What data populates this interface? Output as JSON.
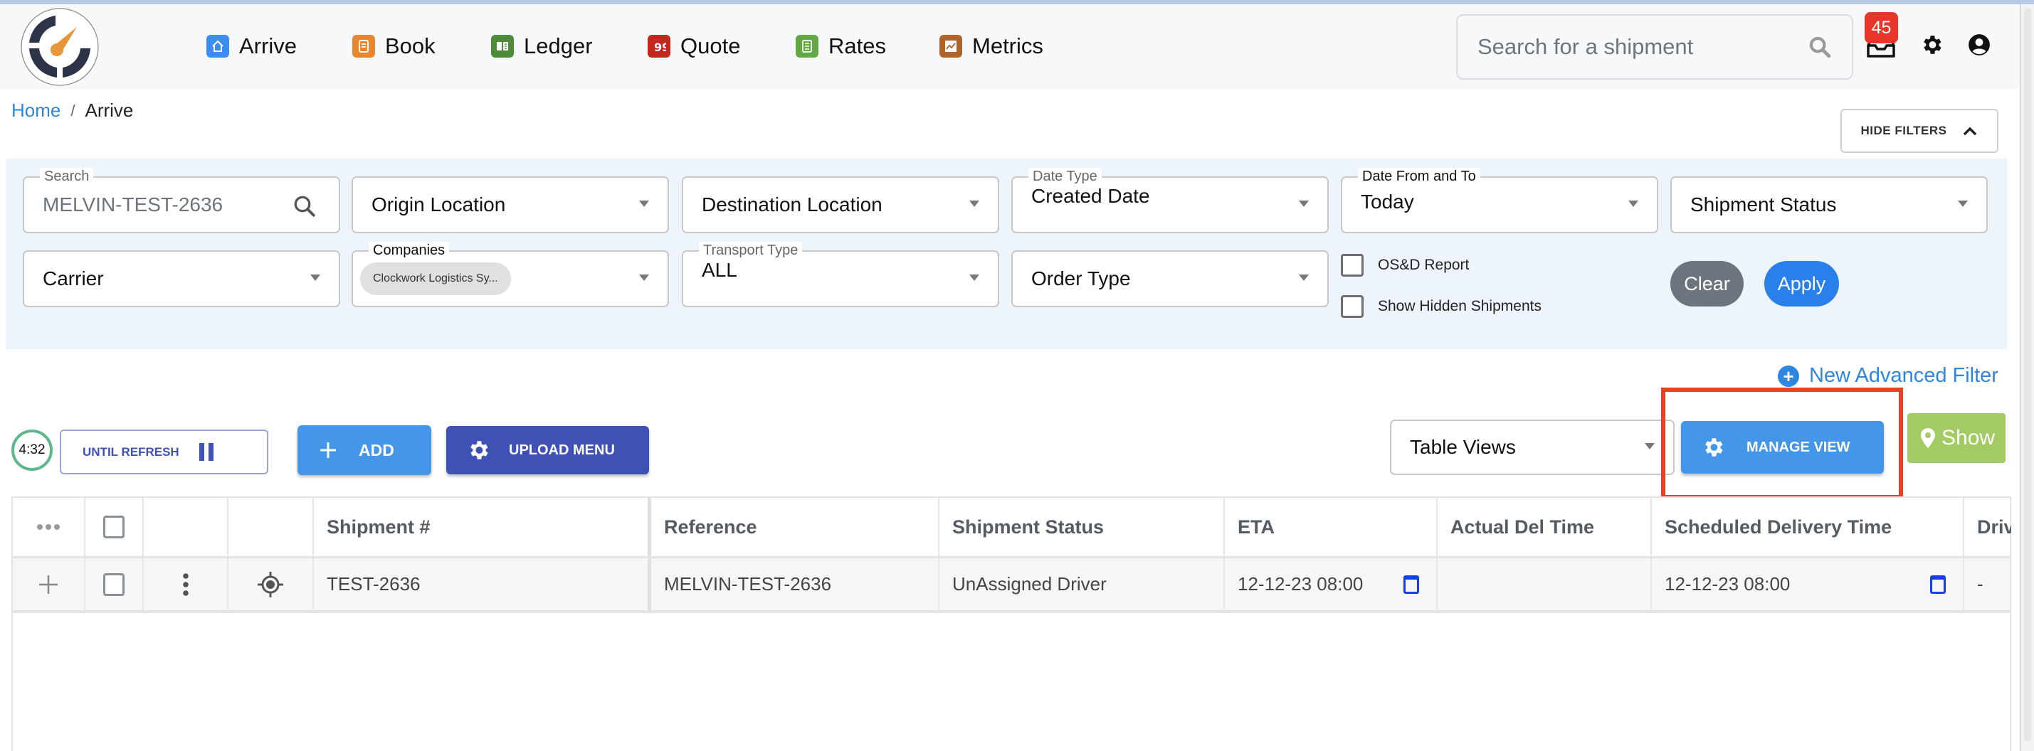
{
  "header": {
    "logo_alt": "clock-gauge-logo",
    "nav": [
      {
        "label": "Arrive",
        "icon": "home-icon",
        "color": "#3b8ef0"
      },
      {
        "label": "Book",
        "icon": "book-icon",
        "color": "#e8862f"
      },
      {
        "label": "Ledger",
        "icon": "open-book-icon",
        "color": "#4e8a3a"
      },
      {
        "label": "Quote",
        "icon": "quote-icon",
        "color": "#c3281f"
      },
      {
        "label": "Rates",
        "icon": "list-icon",
        "color": "#62a844"
      },
      {
        "label": "Metrics",
        "icon": "chart-icon",
        "color": "#b0622b"
      }
    ],
    "search_placeholder": "Search for a shipment",
    "notification_count": "45"
  },
  "breadcrumb": {
    "home": "Home",
    "separator": "/",
    "current": "Arrive"
  },
  "hide_filters_label": "HIDE FILTERS",
  "filters": {
    "search": {
      "label": "Search",
      "value": "MELVIN-TEST-2636"
    },
    "origin_location": "Origin Location",
    "destination_location": "Destination Location",
    "date_type": {
      "label": "Date Type",
      "value": "Created Date"
    },
    "date_range": {
      "label": "Date From and To",
      "value": "Today"
    },
    "shipment_status": "Shipment Status",
    "carrier": "Carrier",
    "companies": {
      "label": "Companies",
      "chip": "Clockwork Logistics Sy..."
    },
    "transport_type": {
      "label": "Transport Type",
      "value": "ALL"
    },
    "order_type": "Order Type",
    "osd_report": {
      "label": "OS&D Report",
      "checked": false
    },
    "show_hidden": {
      "label": "Show Hidden Shipments",
      "checked": false
    },
    "clear_label": "Clear",
    "apply_label": "Apply"
  },
  "toolbar": {
    "new_advanced_filter": "New Advanced Filter",
    "timer": "4:32",
    "until_refresh": "UNTIL REFRESH",
    "add": "ADD",
    "upload_menu": "UPLOAD MENU",
    "table_views": "Table Views",
    "manage_view": "MANAGE VIEW",
    "show": "Show"
  },
  "colors": {
    "primary": "#4496e8",
    "indigo": "#3f51b5",
    "highlight": "#e8402a",
    "success": "#a2cc63",
    "link": "#2e86de"
  },
  "table": {
    "columns": [
      "Shipment #",
      "Reference",
      "Shipment Status",
      "ETA",
      "Actual Del Time",
      "Scheduled Delivery Time",
      "Driv"
    ],
    "rows": [
      {
        "shipment_no": "TEST-2636",
        "reference": "MELVIN-TEST-2636",
        "status": "UnAssigned Driver",
        "eta": "12-12-23 08:00",
        "actual_del_time": "",
        "scheduled_delivery_time": "12-12-23 08:00",
        "driver": "-"
      }
    ]
  }
}
